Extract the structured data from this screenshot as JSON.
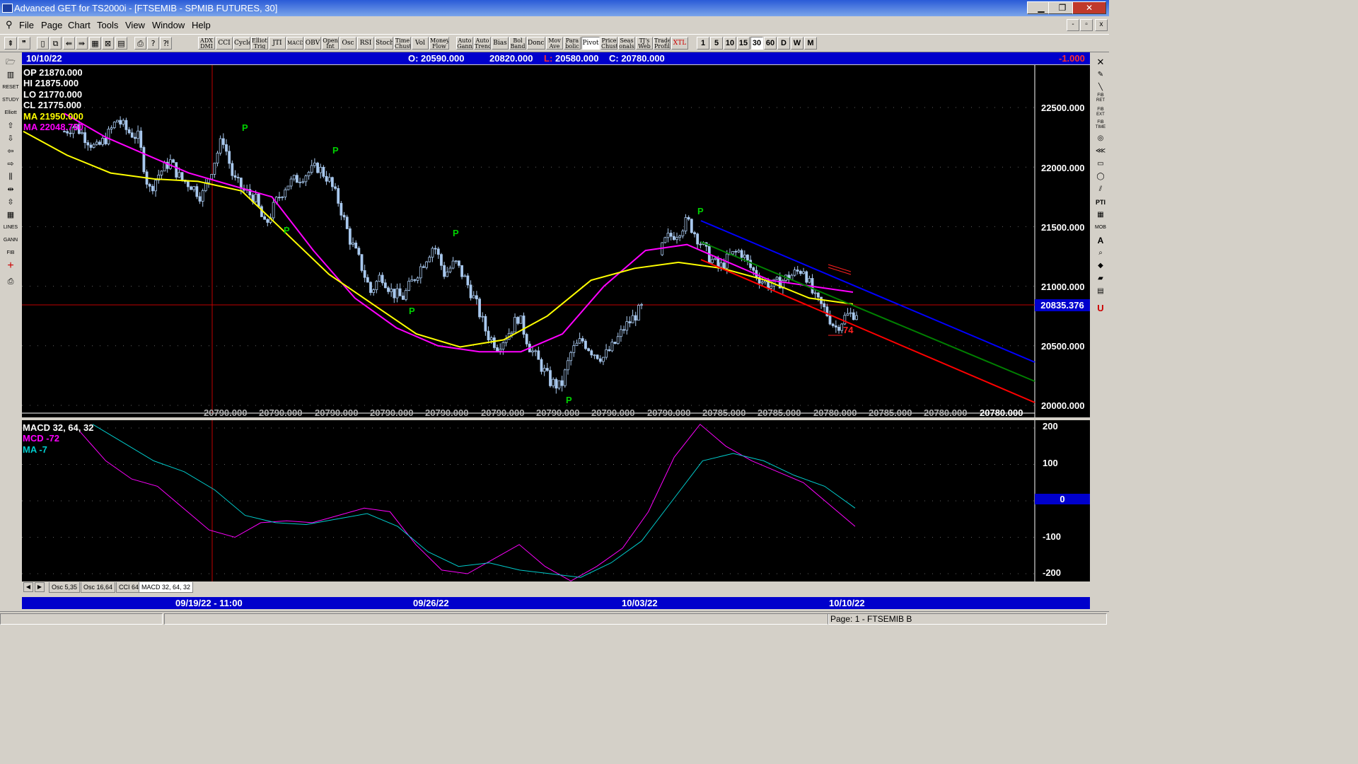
{
  "window": {
    "title": "Advanced GET for TS2000i - [FTSEMIB - SPMIB FUTURES, 30]",
    "buttons": {
      "minimize": "▁",
      "maximize": "❐",
      "close": "✕"
    }
  },
  "menu": [
    "File",
    "Page",
    "Chart",
    "Tools",
    "View",
    "Window",
    "Help"
  ],
  "mdi_buttons": {
    "minimize": "-",
    "restore": "▫",
    "close": "x"
  },
  "toolbar": {
    "left_icons": [
      "cursor-icon",
      "quote-icon",
      "new-page-icon",
      "copy-page-icon",
      "back-icon",
      "forward-icon",
      "grid-icon",
      "cross-icon",
      "layout-icon",
      "print-icon",
      "info-icon",
      "help-icon"
    ],
    "studies": [
      "ADX DMI",
      "CCI",
      "Cycles",
      "Elliott Trig",
      "JTI",
      "MACD",
      "OBV",
      "Open Int",
      "Osc",
      "RSI",
      "Stoch",
      "Time Chust",
      "Vol",
      "Money Flow",
      "Auto Gann",
      "Auto Trend",
      "Bias",
      "Bol Band",
      "Donch",
      "Mov Ave",
      "Para bolic",
      "Pivot",
      "Price Chust",
      "Seas onals",
      "TJ's Web",
      "Trade Profile",
      "XTL"
    ],
    "periods": [
      "1",
      "5",
      "10",
      "15",
      "30",
      "60",
      "D",
      "W",
      "M"
    ],
    "selected_period": "30"
  },
  "left_tools": [
    "folder-icon",
    "bar-icon",
    "reset-icon",
    "study-icon",
    "elliott-icon",
    "up-arrow-icon",
    "down-arrow-icon",
    "left-arrow-icon",
    "right-arrow-icon",
    "bars-icon",
    "expand-icon",
    "compress-icon",
    "window-icon",
    "lines-icon",
    "gann-icon",
    "fib-icon",
    "crosshair-icon",
    "print-icon"
  ],
  "right_tools": [
    "close-x-icon",
    "pencil-icon",
    "line-icon",
    "fib-ret-icon",
    "fib-ext-icon",
    "fib-time-icon",
    "ellipse-icon",
    "fan-icon",
    "box-icon",
    "ellipse-2-icon",
    "channel-icon",
    "pti-icon",
    "grid-icon",
    "mob-icon",
    "text-icon",
    "zoom-icon",
    "paint-icon",
    "eraser-icon",
    "properties-icon",
    "undo-icon"
  ],
  "right_tool_labels": {
    "fib_ret": "FIB RET",
    "fib_ext": "FIB EXT",
    "fib_time": "FIB TIME",
    "pti": "PTI",
    "mob": "MOB",
    "text": "A",
    "undo": "U"
  },
  "info_bar": {
    "date": "10/10/22",
    "open": "O: 20590.000",
    "high": "20820.000",
    "low_label": "L:",
    "low": "20580.000",
    "close": "C: 20780.000",
    "change": "-1.000"
  },
  "bar_stats": {
    "op": "OP  21870.000",
    "hi": "HI   21875.000",
    "lo": "LO  21770.000",
    "cl": "CL  21775.000",
    "ma1": "MA  21950.000",
    "ma2": "MA  22048.750"
  },
  "price_axis": [
    "22500.000",
    "22000.000",
    "21500.000",
    "21000.000",
    "20500.000",
    "20000.000"
  ],
  "current_price": "20835.376",
  "bottom_values": [
    "20790.000",
    "20790.000",
    "20790.000",
    "20790.000",
    "20790.000",
    "20790.000",
    "20790.000",
    "20790.000",
    "20790.000",
    "20785.000",
    "20785.000",
    "20780.000",
    "20785.000",
    "20780.000",
    "20780.000"
  ],
  "pivot_label": "P",
  "channel_label": "74",
  "osc": {
    "title": "MACD 32, 64, 32",
    "mcd": "MCD -72",
    "ma": "MA    -7",
    "axis": [
      "200",
      "100",
      "0",
      "-100",
      "-200"
    ]
  },
  "tabs": [
    "Osc 5,35",
    "Osc 16,64",
    "CCI 64",
    "MACD 32, 64, 32"
  ],
  "active_tab": "MACD 32, 64, 32",
  "dates": [
    "09/19/22 - 11:00",
    "09/26/22",
    "10/03/22",
    "10/10/22"
  ],
  "status": "Page: 1 - FTSEMIB B",
  "colors": {
    "chart_bg": "#000000",
    "info_bar": "#0000cc",
    "candle": "#a8c8ee",
    "ma_fast": "#ffff00",
    "ma_slow": "#ff00ff",
    "macd": "#ff00ff",
    "macd_signal": "#00cccc",
    "pivot": "#00d000",
    "channel_upper": "#0000ff",
    "channel_mid": "#008000",
    "channel_lower": "#ff0000",
    "crosshair": "#cc0000"
  },
  "chart_data": {
    "type": "candlestick",
    "symbol": "FTSEMIB - SPMIB FUTURES",
    "interval": "30",
    "ylim": [
      20000,
      22750
    ],
    "price_ticks": [
      20000,
      20500,
      21000,
      21500,
      22000,
      22500
    ],
    "close_path": [
      22300,
      22350,
      22250,
      22150,
      22250,
      22400,
      22300,
      22250,
      21800,
      21950,
      22050,
      21900,
      21850,
      21750,
      22000,
      22250,
      21900,
      21800,
      21750,
      21500,
      21700,
      21850,
      21900,
      21950,
      22000,
      21900,
      21700,
      21400,
      21200,
      20950,
      21100,
      20950,
      20900,
      21050,
      21200,
      21350,
      21100,
      21200,
      21050,
      20850,
      20600,
      20500,
      20600,
      20750,
      20500,
      20350,
      20200,
      20150,
      20450,
      20550,
      20450,
      20400,
      20500,
      20650,
      20750,
      20850,
      21200,
      21400,
      21450,
      21550,
      21400,
      21250,
      21150,
      21250,
      21300,
      21150,
      21050,
      21000,
      21050,
      21100,
      21150,
      20900,
      20800,
      20650,
      20750,
      20780
    ],
    "ma_fast": [
      22300,
      22100,
      21950,
      21900,
      21880,
      21800,
      21450,
      21100,
      20850,
      20600,
      20490,
      20550,
      20750,
      21050,
      21150,
      21200,
      21150,
      21050,
      20900,
      20850
    ],
    "ma_slow": [
      22450,
      22250,
      22100,
      21950,
      21850,
      21750,
      21300,
      20900,
      20650,
      20500,
      20450,
      20450,
      20600,
      21000,
      21300,
      21350,
      21200,
      21050,
      21000,
      20950
    ],
    "pivots": [
      {
        "type": "high",
        "price": 22300
      },
      {
        "type": "high",
        "price": 22150
      },
      {
        "type": "low",
        "price": 21450
      },
      {
        "type": "high",
        "price": 21400
      },
      {
        "type": "low",
        "price": 20800
      },
      {
        "type": "high",
        "price": 21600
      },
      {
        "type": "low",
        "price": 20050
      }
    ],
    "current_price": 20835.376,
    "macd": {
      "params": [
        32,
        64,
        32
      ],
      "axis": [
        -200,
        -100,
        0,
        100,
        200
      ],
      "mcd_path": [
        190,
        110,
        60,
        40,
        -20,
        -80,
        -100,
        -60,
        -55,
        -60,
        -40,
        -20,
        -30,
        -120,
        -190,
        -200,
        -160,
        -120,
        -180,
        -220,
        -180,
        -130,
        -30,
        120,
        210,
        150,
        110,
        80,
        50,
        -10,
        -70
      ],
      "ma_path": [
        210,
        160,
        110,
        80,
        30,
        -40,
        -60,
        -65,
        -50,
        -35,
        -70,
        -140,
        -180,
        -170,
        -190,
        -200,
        -210,
        -170,
        -110,
        0,
        110,
        130,
        110,
        70,
        40,
        -20
      ],
      "mcd_last": -72,
      "ma_last": -7
    }
  }
}
